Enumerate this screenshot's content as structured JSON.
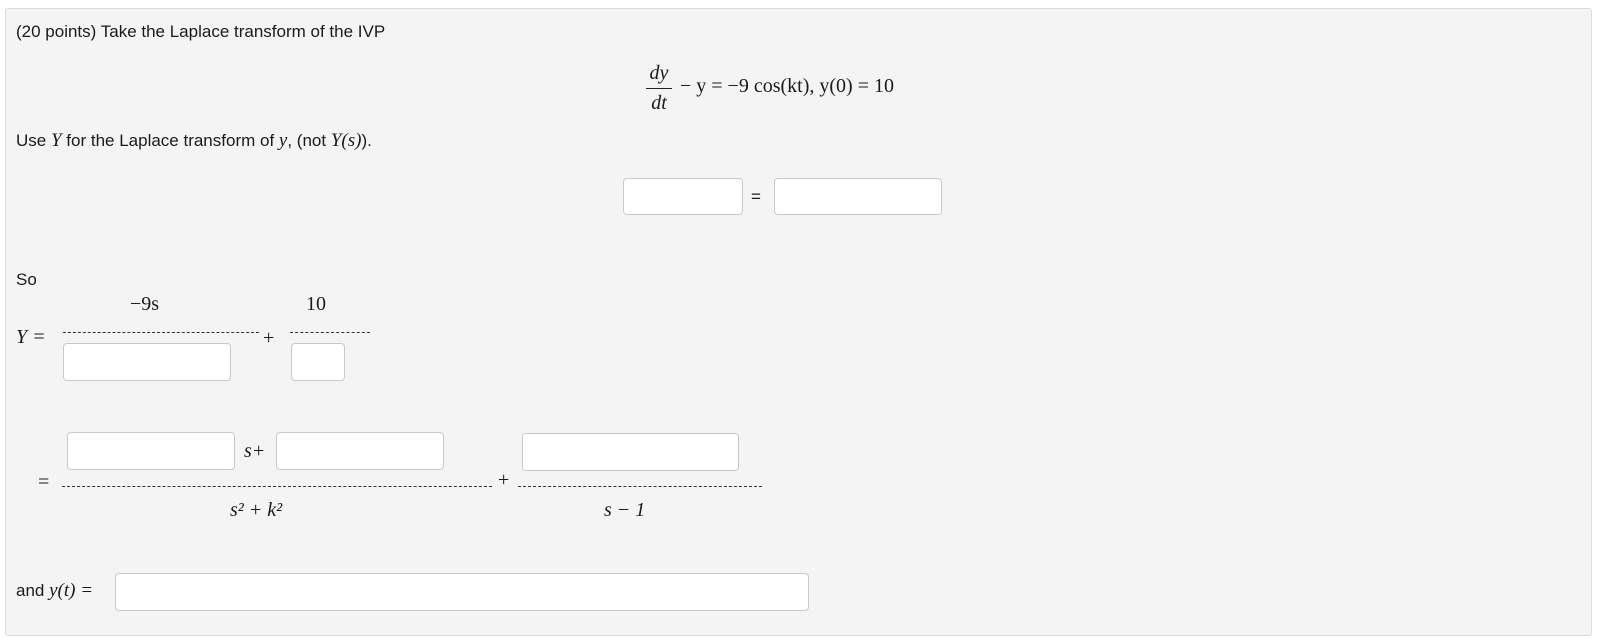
{
  "problem": {
    "points_label": "(20 points) Take the Laplace transform of the IVP",
    "eq_dy": "dy",
    "eq_dt": "dt",
    "eq_rest": "− y = −9 cos(kt), y(0) = 10"
  },
  "instruction": {
    "use": "Use",
    "Y": "Y",
    "mid": "for the Laplace transform of",
    "y": "y",
    "tail_open": ", (not",
    "Ys": "Y(s)",
    "tail_close": ")."
  },
  "transform_eq": {
    "equals": "=",
    "left_value": "",
    "right_value": ""
  },
  "so_section": {
    "so": "So",
    "Y_eq": "Y =",
    "num1": "−9s",
    "num2": "10",
    "plus": "+",
    "den1_value": "",
    "den2_value": ""
  },
  "partial_fractions": {
    "equals": "=",
    "coef1_value": "",
    "s_plus": "s+",
    "coef2_value": "",
    "den1": "s² + k²",
    "plus": "+",
    "coef3_value": "",
    "den2": "s − 1"
  },
  "final_answer": {
    "label_and": "and",
    "label_yt": "y(t) =",
    "value": ""
  }
}
